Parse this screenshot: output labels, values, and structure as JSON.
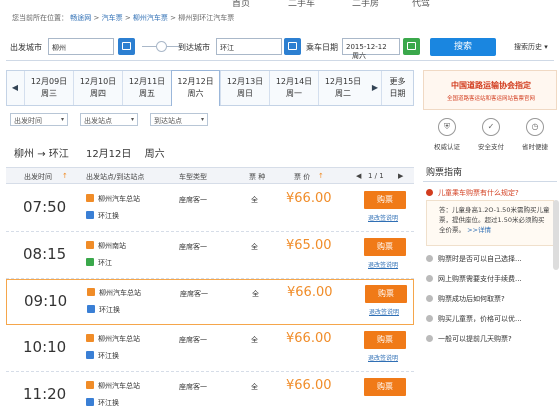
{
  "topbar": {
    "items": [
      "首页",
      "二手车",
      "二手房",
      "代驾"
    ]
  },
  "breadcrumb": {
    "prefix": "您当前所在位置：",
    "items": [
      "畅途网",
      "汽车票",
      "柳州汽车票",
      "柳州到环江汽车票"
    ],
    "sep": ">"
  },
  "search": {
    "from_label": "出发城市",
    "from_value": "柳州",
    "to_label": "到达城市",
    "to_value": "环江",
    "date_label": "乘车日期",
    "date_value": "2015-12-12",
    "weekday": "周六",
    "search_button": "搜索",
    "history": "搜索历史 ▾"
  },
  "date_tabs": [
    {
      "date": "12月09日",
      "day": "周三"
    },
    {
      "date": "12月10日",
      "day": "周四"
    },
    {
      "date": "12月11日",
      "day": "周五"
    },
    {
      "date": "12月12日",
      "day": "周六",
      "selected": true
    },
    {
      "date": "12月13日",
      "day": "周日"
    },
    {
      "date": "12月14日",
      "day": "周一"
    },
    {
      "date": "12月15日",
      "day": "周二"
    }
  ],
  "more_dates": {
    "line1": "更多",
    "line2": "日期"
  },
  "filters": [
    "出发时间",
    "出发站点",
    "到达站点"
  ],
  "route": {
    "from": "柳州",
    "arrow": "→",
    "to": "环江",
    "date": "12月12日",
    "weekday": "周六"
  },
  "table_header": {
    "time": "出发时间",
    "station": "出发站点/到达站点",
    "type": "车型类型",
    "ticket": "票 种",
    "price": "票 价",
    "page": "1 / 1"
  },
  "rows": [
    {
      "time": "07:50",
      "from": "柳州汽车总站",
      "to": "环江换",
      "type": "座席客一",
      "ticket": "全",
      "price": "¥66.00",
      "buy": "购票",
      "refund": "退改签说明"
    },
    {
      "time": "08:15",
      "from": "柳州南站",
      "to": "环江",
      "type": "座席客一",
      "ticket": "全",
      "price": "¥65.00",
      "buy": "购票",
      "refund": "退改签说明"
    },
    {
      "time": "09:10",
      "from": "柳州汽车总站",
      "to": "环江换",
      "type": "座席客一",
      "ticket": "全",
      "price": "¥66.00",
      "buy": "购票",
      "refund": "退改签说明"
    },
    {
      "time": "10:10",
      "from": "柳州汽车总站",
      "to": "环江换",
      "type": "座席客一",
      "ticket": "全",
      "price": "¥66.00",
      "buy": "购票",
      "refund": "退改签说明"
    },
    {
      "time": "11:20",
      "from": "柳州汽车总站",
      "to": "环江换",
      "type": "座席客一",
      "ticket": "全",
      "price": "¥66.00",
      "buy": "购票",
      "refund": ""
    }
  ],
  "sidebar": {
    "banner_title": "中国道路运输协会指定",
    "banner_sub": "全国道路客运站和客运网站售票官网",
    "services": [
      {
        "label": "权威认证",
        "icon": "shield-icon",
        "glyph": "⛨"
      },
      {
        "label": "安全支付",
        "icon": "lock-icon",
        "glyph": "✓"
      },
      {
        "label": "省时便捷",
        "icon": "clock-icon",
        "glyph": "◷"
      }
    ],
    "guide_title": "购票指南",
    "faqs": [
      "儿童乘车购票有什么规定?",
      "购票时是否可以自己选择...",
      "网上购票需要支付手续费...",
      "购票成功后如何取票?",
      "购买儿童票，价格可以优...",
      "一般可以提前几天购票?"
    ],
    "answer": "答：儿童身高1.2O-1.50米需购买儿童票，提供座位。超过1.50米必须购买全价票。",
    "answer_detail": ">>详情"
  }
}
